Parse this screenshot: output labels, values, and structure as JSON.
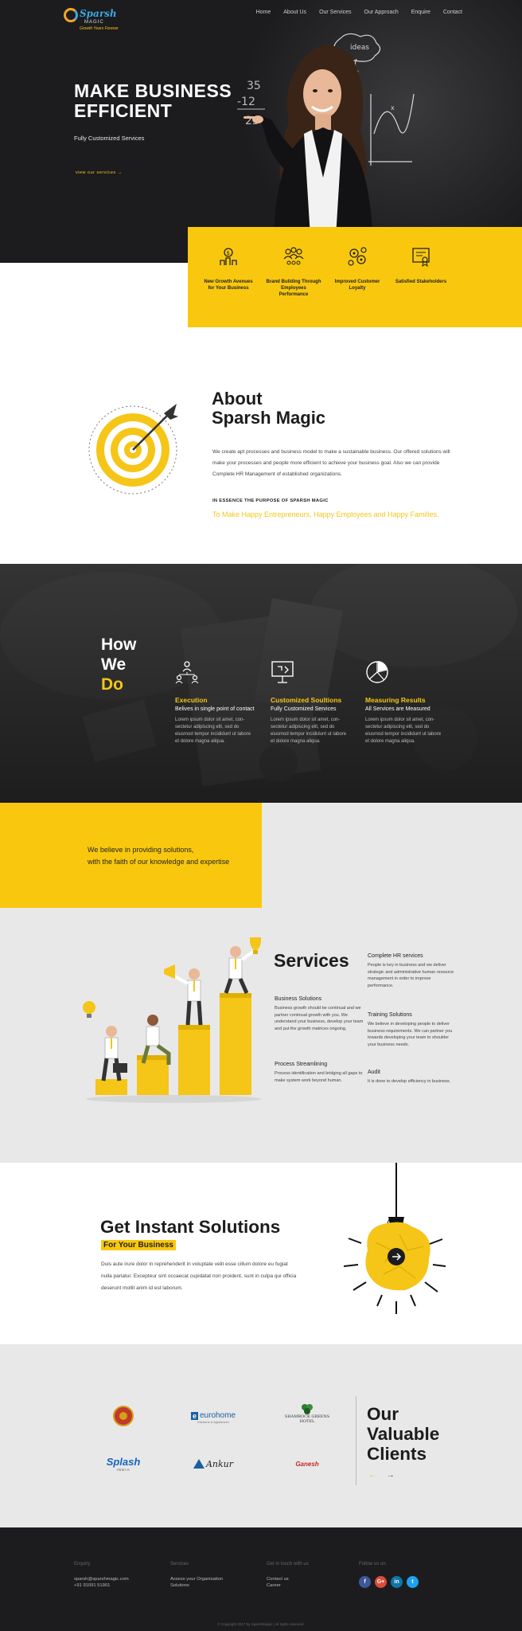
{
  "header": {
    "logo_name": "Sparsh",
    "logo_sub": "MAGIC",
    "logo_tagline": "Growth Years Forever",
    "nav": [
      "Home",
      "About Us",
      "Our Services",
      "Our Approach",
      "Enquire",
      "Contact"
    ]
  },
  "hero": {
    "title": "MAKE BUSINESS EFFICIENT",
    "subtitle": "Fully Customized Services",
    "link": "view our services →",
    "chalk": {
      "num1": "35",
      "num2": "-12",
      "num3": "23",
      "ideas": "ideas"
    }
  },
  "stats": [
    {
      "icon": "money-growth-icon",
      "label": "New Growth Avenues for Your Business"
    },
    {
      "icon": "team-icon",
      "label": "Brand Building Through Employees Performance"
    },
    {
      "icon": "gears-icon",
      "label": "Improved Customer Loyalty"
    },
    {
      "icon": "certificate-icon",
      "label": "Satisfied Stakeholders"
    }
  ],
  "about": {
    "title_line1": "About",
    "title_line2": "Sparsh Magic",
    "text": "We create apt processes and business model to make a sustainable business. Our offered solutions will make your processes and people more efficient to achieve your business goal. Also we can provide Complete HR Management of established organizations.",
    "essence_label": "IN ESSENCE THE PURPOSE OF SPARSH MAGIC",
    "mission": "To Make Happy Entrepreneurs, Happy Employees and Happy Families."
  },
  "how": {
    "title_line1": "How",
    "title_line2": "We",
    "title_line3": "Do",
    "items": [
      {
        "icon": "hierarchy-icon",
        "title": "Execution",
        "subtitle": "Belives in single point of contact",
        "body": "Lorem ipsum dolor sit amet, con-sectetur adipiscing elit, sed do eiusmod tempor incididunt ut labore et dolore magna aliqua."
      },
      {
        "icon": "presentation-icon",
        "title": "Customized Soultions",
        "subtitle": "Fully Customized Services",
        "body": "Lorem ipsum dolor sit amet, con-sectetur adipiscing elit, sed do eiusmod tempor incididunt ut labore et dolore magna aliqua."
      },
      {
        "icon": "pie-chart-icon",
        "title": "Measuring Results",
        "subtitle": "All Services are Measured",
        "body": "Lorem ipsum dolor sit amet, con-sectetur adipiscing elit, sed do eiusmod tempor incididunt ut labore et dolore magna aliqua."
      }
    ]
  },
  "believe": {
    "line1": "We believe in providing solutions,",
    "line2": "with the faith of our knowledge and expertise"
  },
  "services": {
    "title": "Services",
    "items": [
      {
        "title": "Complete HR services",
        "body": "People is key in business and we deliver strategic and administrative human resource management in order to improve performance."
      },
      {
        "title": "Business Solutions",
        "body": "Business growth should be continual and we partner continual growth with you. We understand your business, develop your team and put the growth matrices ongoing."
      },
      {
        "title": "Training Solutions",
        "body": "We believe in developing people to deliver business requirements. We can partner you towards developing your team to shoulder your business needs."
      },
      {
        "title": "Process Streamlining",
        "body": "Process identification and bridging all gaps to make system work beyond human."
      },
      {
        "title": "Audit",
        "body": "It is done to develop efficiency in business."
      }
    ]
  },
  "instant": {
    "title": "Get Instant Solutions",
    "subtitle": "For Your Business",
    "text": "Duis aute irure dolor in reprehenderit in voluptate velit esse cillum dolore eu fugiat nulla pariatur. Excepteur sint occaecat cupidatat non proident, sunt in culpa qui officia deserunt mollit anim id est laborum."
  },
  "clients": {
    "title_line1": "Our",
    "title_line2": "Valuable",
    "title_line3": "Clients",
    "logos": [
      {
        "name": "crest-logo",
        "text": ""
      },
      {
        "name": "eurohome-logo",
        "text": "eurohome"
      },
      {
        "name": "shamrock-logo",
        "text": "SHAMROCK GREENS HOTEL"
      },
      {
        "name": "splash-logo",
        "text": "Splash"
      },
      {
        "name": "ankur-logo",
        "text": "Ankur"
      },
      {
        "name": "ganesh-logo",
        "text": "Ganesh"
      }
    ],
    "splash_sub": "INDIA",
    "eurohome_sub": "Kitchens & Appliances",
    "arrow_prev": "←",
    "arrow_next": "→"
  },
  "footer": {
    "enquiry_head": "Enquiry",
    "enquiry_email": "sparsh@sparshmagic.com",
    "enquiry_phone": "+91 91091 51901",
    "services_head": "Services",
    "services_l1": "Assess your Organisation",
    "services_l2": "Solutions",
    "get_head": "Get in touch with us",
    "get_l1": "Contact us",
    "get_l2": "Career",
    "follow_head": "Follow us on",
    "social": [
      {
        "name": "facebook-icon",
        "glyph": "f",
        "color": "#3b5998"
      },
      {
        "name": "google-plus-icon",
        "glyph": "G+",
        "color": "#dd4b39"
      },
      {
        "name": "linkedin-icon",
        "glyph": "in",
        "color": "#0e76a8"
      },
      {
        "name": "twitter-icon",
        "glyph": "t",
        "color": "#1da1f2"
      }
    ],
    "copyright": "© Copyright 2017 by SparshMagic | All rights reserved."
  },
  "colors": {
    "accent": "#f9c80e",
    "dark": "#1c1c1e",
    "light_gray": "#e8e8e8"
  }
}
